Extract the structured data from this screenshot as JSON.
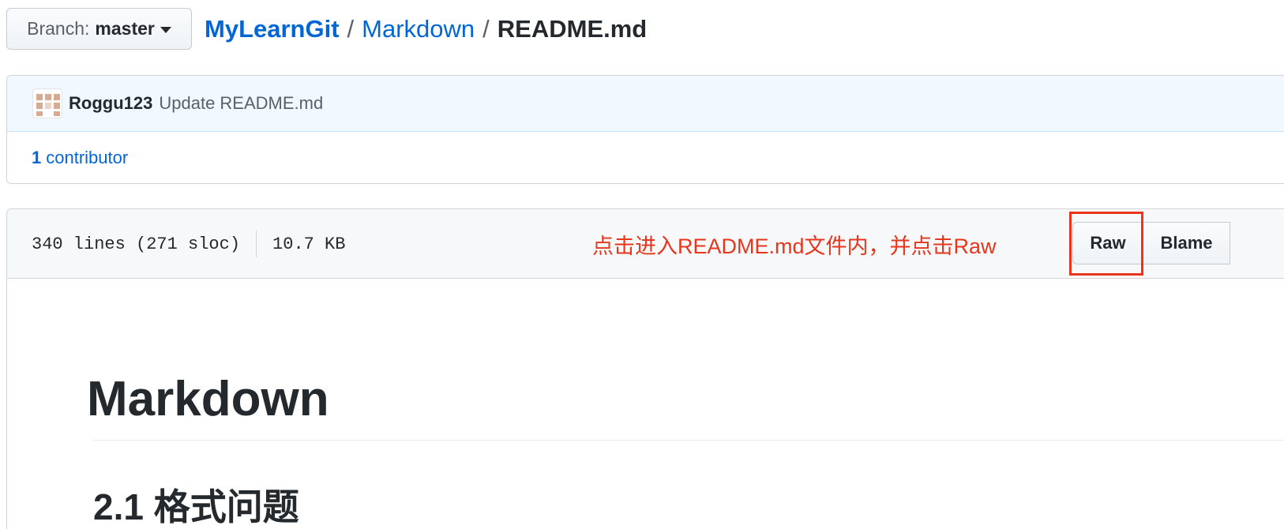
{
  "branch": {
    "label": "Branch:",
    "value": "master"
  },
  "breadcrumb": {
    "repo": "MyLearnGit",
    "folder": "Markdown",
    "file": "README.md",
    "separator": "/"
  },
  "commit": {
    "author": "Roggu123",
    "message": "Update README.md",
    "contributors_count": "1",
    "contributors_label": "contributor"
  },
  "file": {
    "lines": "340 lines (271 sloc)",
    "size": "10.7 KB",
    "annotation": "点击进入README.md文件内，并点击Raw",
    "buttons": {
      "raw": "Raw",
      "blame": "Blame"
    }
  },
  "readme": {
    "h1": "Markdown",
    "h2": "2.1 格式问题"
  },
  "colors": {
    "link": "#0366d6",
    "annotation": "#e8361c",
    "commit_bg": "#f1f8ff",
    "header_bg": "#f6f8fa"
  }
}
